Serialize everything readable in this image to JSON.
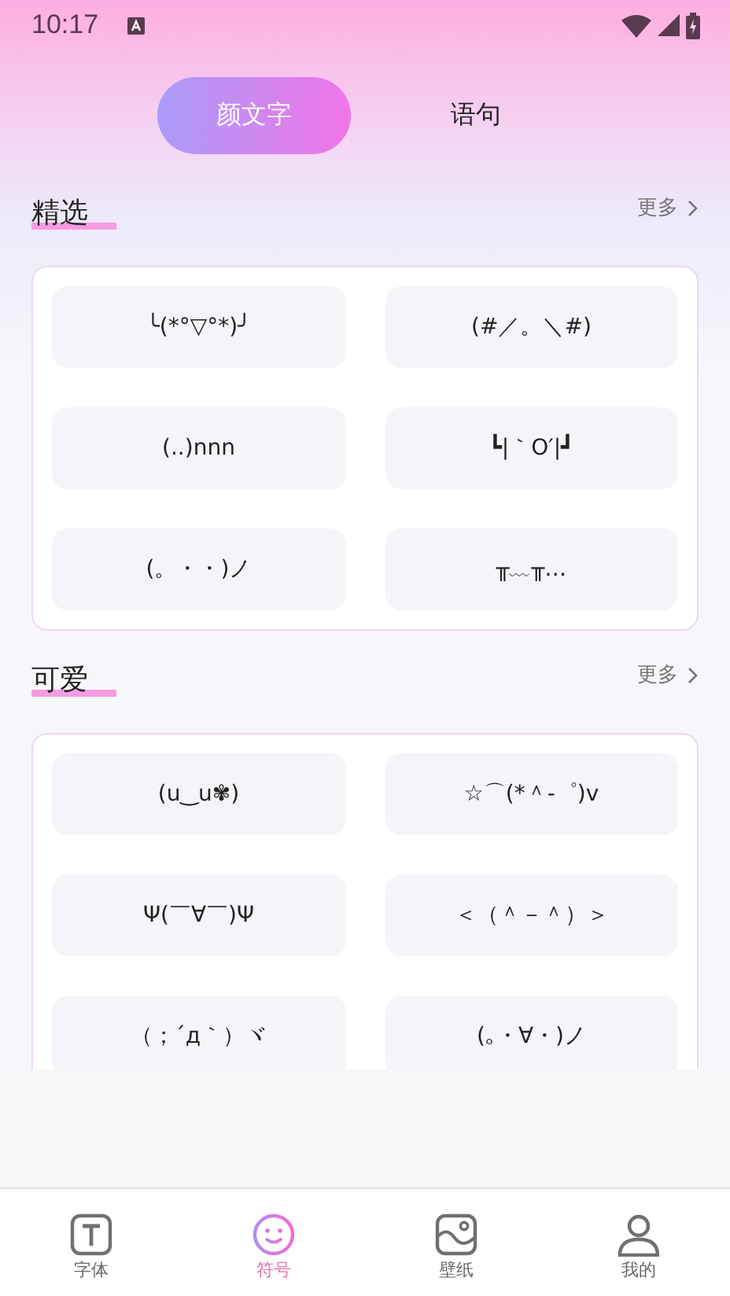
{
  "status_bar": {
    "time": "10:17"
  },
  "tabs": [
    {
      "label": "颜文字",
      "selected": true
    },
    {
      "label": "语句",
      "selected": false
    }
  ],
  "sections": [
    {
      "title": "精选",
      "more": "更多",
      "items": [
        "╰(*°▽°*)╯",
        "(#／。＼#)",
        "(..)nnn",
        "┗|｀O′|┛",
        "(。・・)ノ",
        "╥﹏╥…"
      ]
    },
    {
      "title": "可爱",
      "more": "更多",
      "items": [
        "(u‿u✾)",
        "☆⌒(*＾-゜)v",
        "Ψ(￣∀￣)Ψ",
        "＜（＾－＾）＞",
        "（；´д｀）ヾ",
        "(｡・∀・)ノ"
      ]
    }
  ],
  "nav": [
    {
      "kind": "font",
      "label": "字体",
      "selected": false
    },
    {
      "kind": "symbol",
      "label": "符号",
      "selected": true
    },
    {
      "kind": "wallpaper",
      "label": "壁纸",
      "selected": false
    },
    {
      "kind": "profile",
      "label": "我的",
      "selected": false
    }
  ]
}
